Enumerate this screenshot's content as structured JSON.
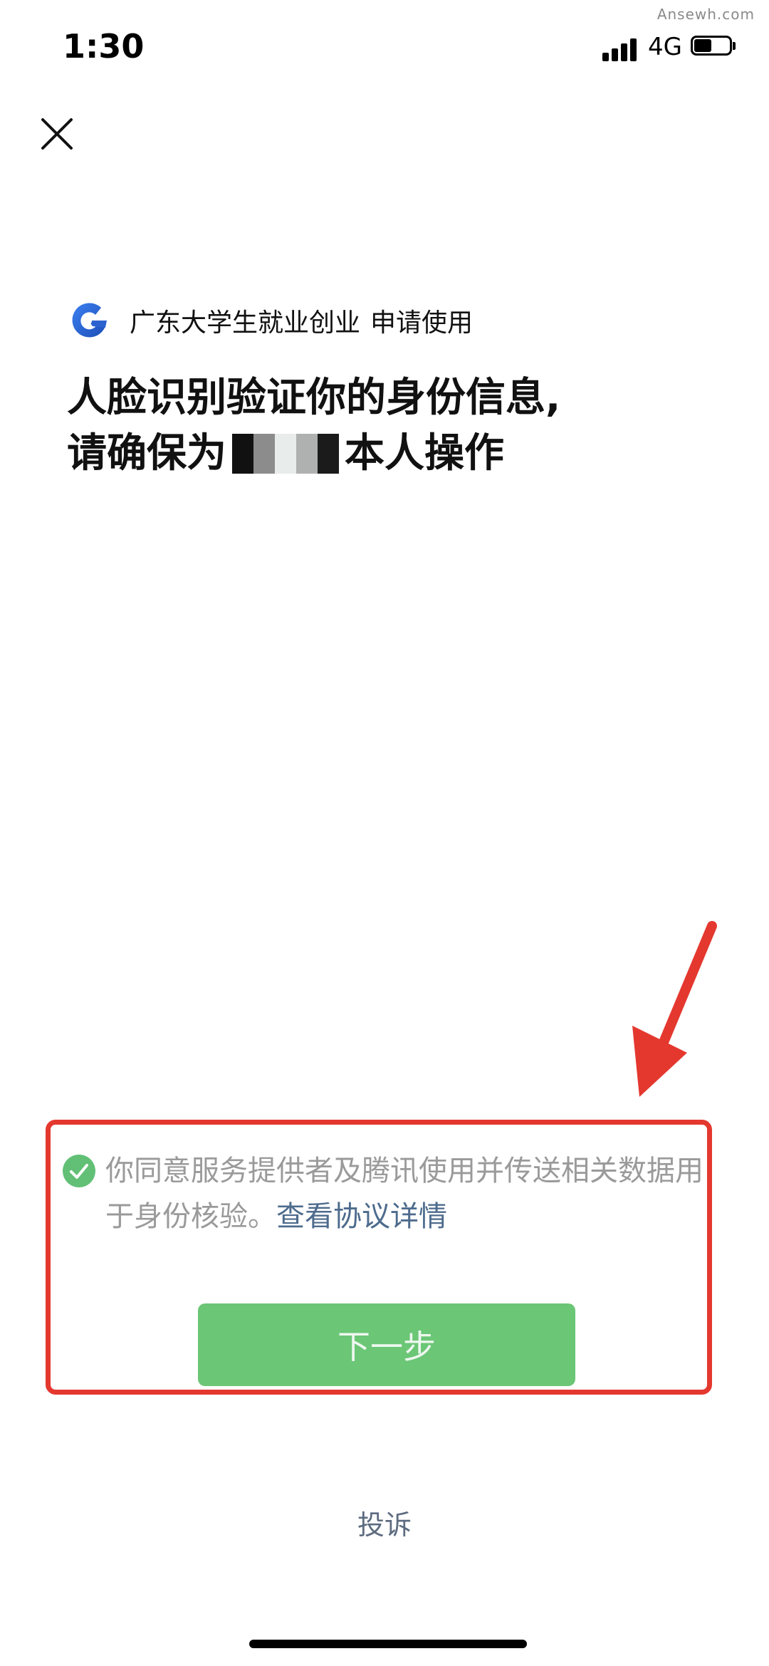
{
  "watermark": "Ansewh.com",
  "status_bar": {
    "time": "1:30",
    "network": "4G",
    "signal_bars": 4,
    "battery_level": 0.45
  },
  "header": {
    "close_icon": "close-icon"
  },
  "app": {
    "logo_icon": "app-logo-icon",
    "name": "广东大学生就业创业",
    "request_text": "申请使用"
  },
  "headline": {
    "line1": "人脸识别验证你的身份信息,",
    "line2_prefix": "请确保为",
    "line2_suffix": "本人操作",
    "masked_name_colors": [
      "#111111",
      "#8c8c8c",
      "#e8ecea",
      "#aeb1b0",
      "#1b1b1b"
    ]
  },
  "consent": {
    "checked": true,
    "text": "你同意服务提供者及腾讯使用并传送相关数据用于身份核验。",
    "link_text": "查看协议详情"
  },
  "primary_button": {
    "label": "下一步"
  },
  "footer": {
    "complaint_label": "投诉"
  },
  "colors": {
    "accent_green": "#6bc676",
    "annotation_red": "#e4382f",
    "link_blue": "#4d6b8d"
  }
}
